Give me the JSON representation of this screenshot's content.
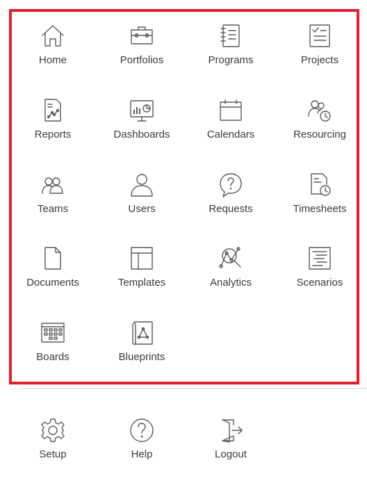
{
  "menu": {
    "items": [
      {
        "label": "Home",
        "icon": "home-icon"
      },
      {
        "label": "Portfolios",
        "icon": "briefcase-icon"
      },
      {
        "label": "Programs",
        "icon": "notebook-icon"
      },
      {
        "label": "Projects",
        "icon": "checklist-icon"
      },
      {
        "label": "Reports",
        "icon": "report-icon"
      },
      {
        "label": "Dashboards",
        "icon": "dashboard-icon"
      },
      {
        "label": "Calendars",
        "icon": "calendar-icon"
      },
      {
        "label": "Resourcing",
        "icon": "resourcing-icon"
      },
      {
        "label": "Teams",
        "icon": "teams-icon"
      },
      {
        "label": "Users",
        "icon": "user-icon"
      },
      {
        "label": "Requests",
        "icon": "request-icon"
      },
      {
        "label": "Timesheets",
        "icon": "timesheet-icon"
      },
      {
        "label": "Documents",
        "icon": "document-icon"
      },
      {
        "label": "Templates",
        "icon": "template-icon"
      },
      {
        "label": "Analytics",
        "icon": "analytics-icon"
      },
      {
        "label": "Scenarios",
        "icon": "scenario-icon"
      },
      {
        "label": "Boards",
        "icon": "board-icon"
      },
      {
        "label": "Blueprints",
        "icon": "blueprint-icon"
      }
    ]
  },
  "footer": {
    "items": [
      {
        "label": "Setup",
        "icon": "gear-icon"
      },
      {
        "label": "Help",
        "icon": "help-icon"
      },
      {
        "label": "Logout",
        "icon": "logout-icon"
      }
    ]
  },
  "colors": {
    "frame": "#e31d2b",
    "icon": "#5a5a5a",
    "text": "#3b3b3b",
    "divider": "#d6d6d6"
  }
}
